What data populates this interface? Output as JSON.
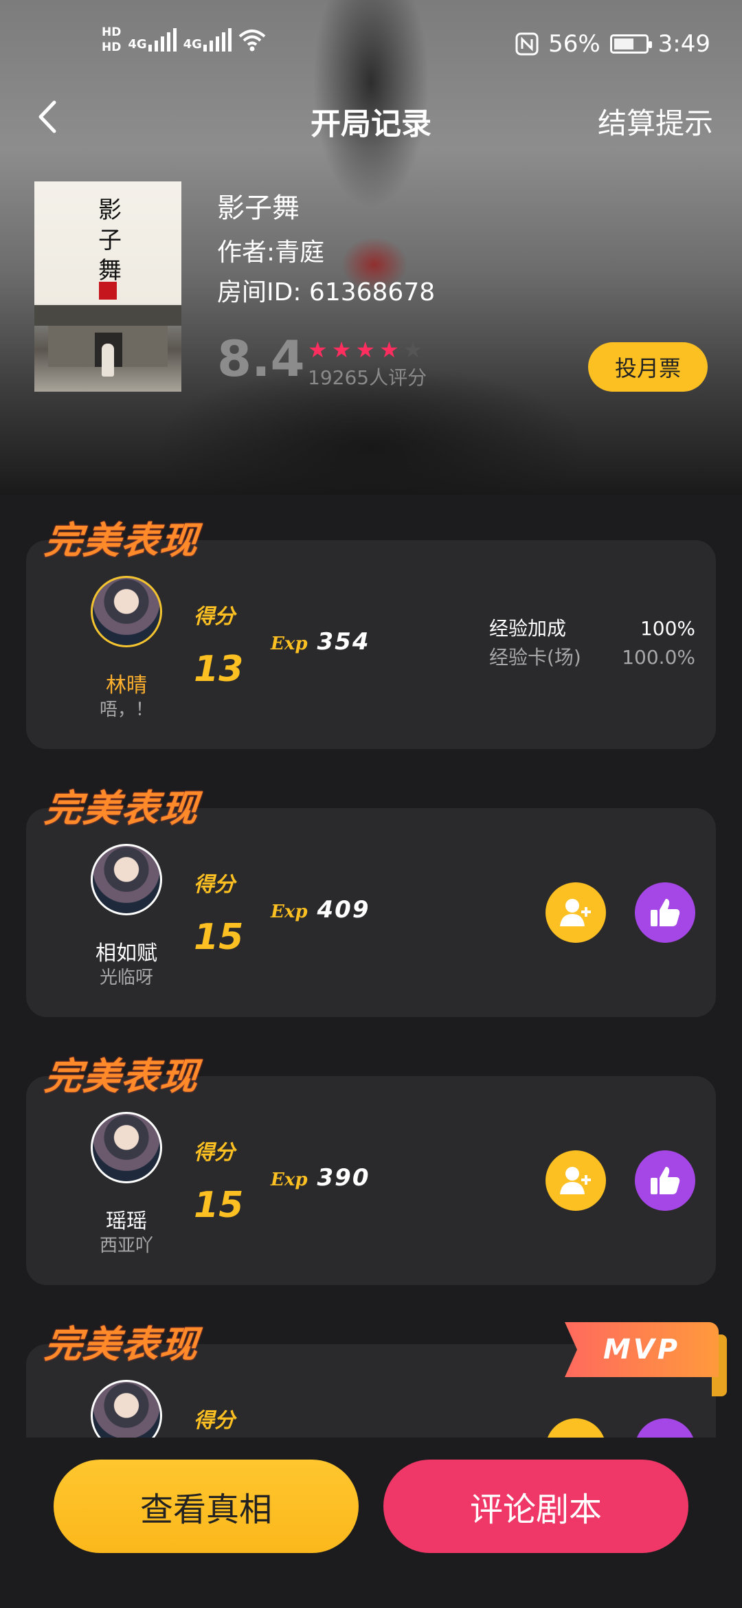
{
  "status_bar": {
    "hd1": "HD",
    "hd2": "HD",
    "net1": "4G",
    "net2": "4G",
    "battery_pct": "56%",
    "time": "3:49"
  },
  "nav": {
    "title": "开局记录",
    "right_action": "结算提示"
  },
  "book": {
    "cover_title": "影子舞",
    "name": "影子舞",
    "author": "作者:青庭",
    "room_id": "房间ID: 61368678",
    "rating": "8.4",
    "stars": 4.5,
    "rating_count": "19265人评分",
    "vote_button": "投月票"
  },
  "players": [
    {
      "section_title": "完美表现",
      "name": "林晴",
      "subtitle": "唔，！",
      "score_label": "得分",
      "score": "13",
      "exp_label": "Exp",
      "exp": "354",
      "bonus": [
        {
          "label": "经验加成",
          "value": "100%"
        },
        {
          "label": "经验卡(场)",
          "value": "100.0%"
        }
      ]
    },
    {
      "section_title": "完美表现",
      "name": "相如赋",
      "subtitle": "光临呀",
      "score_label": "得分",
      "score": "15",
      "exp_label": "Exp",
      "exp": "409"
    },
    {
      "section_title": "完美表现",
      "name": "瑶瑶",
      "subtitle": "西亚吖",
      "score_label": "得分",
      "score": "15",
      "exp_label": "Exp",
      "exp": "390"
    },
    {
      "section_title": "完美表现",
      "score_label": "得分",
      "badge": "MVP"
    }
  ],
  "bottom": {
    "truth_button": "查看真相",
    "comment_button": "评论剧本"
  },
  "colors": {
    "accent_yellow": "#fcc022",
    "accent_pink": "#ef3867",
    "accent_purple": "#a546e6",
    "card_bg": "#2a2a2c",
    "page_bg": "#1c1c1e"
  }
}
